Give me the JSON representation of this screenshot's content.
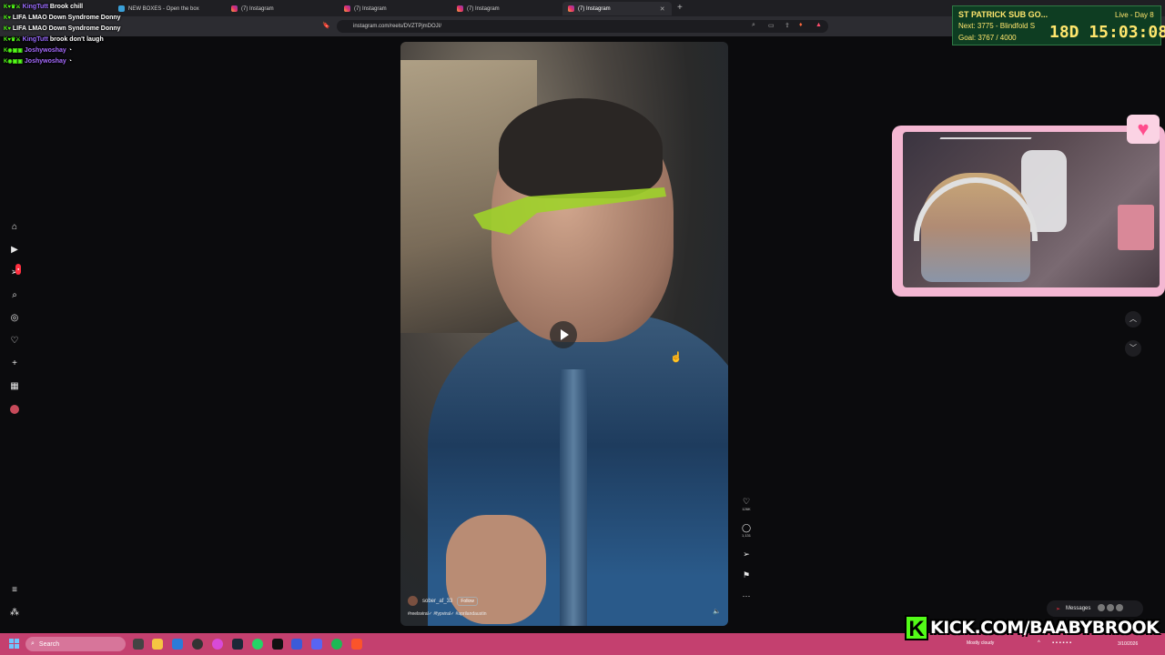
{
  "browser": {
    "tabs": [
      {
        "label": "NEW BOXES - Open the box",
        "active": false
      },
      {
        "label": "(7) Instagram",
        "active": false
      },
      {
        "label": "(7) Instagram",
        "active": false
      },
      {
        "label": "(7) Instagram",
        "active": false
      },
      {
        "label": "(7) Instagram",
        "active": true
      }
    ],
    "url": "instagram.com/reels/DVZTPjmDOJI/"
  },
  "chat": {
    "lines": [
      {
        "user": "KingTutt",
        "message": "Brook chill"
      },
      {
        "user": "LIFA",
        "message": "LMAO Down Syndrome Donny"
      },
      {
        "user": "LIFA",
        "message": "LMAO Down Syndrome Donny"
      },
      {
        "user": "KingTutt",
        "message": "brook don't laugh"
      },
      {
        "user": "Joshywoshay",
        "message": ""
      },
      {
        "user": "Joshywoshay",
        "message": ""
      }
    ]
  },
  "reel": {
    "username": "sober_af_33",
    "follow_label": "Follow",
    "caption": "#reelsviral✓ #fypviral✓ #aprilandaustin",
    "likes": "126K",
    "comments": "1,131"
  },
  "subgoal": {
    "title": "ST PATRICK SUB GO...",
    "live": "Live - Day 8",
    "next": "Next: 3775 - Blindfold S",
    "goal": "Goal: 3767 / 4000",
    "timer": "18D 15:03:08"
  },
  "messages": {
    "label": "Messages"
  },
  "kick": {
    "letter": "K",
    "text": "KICK.COM/BAABYBROOK"
  },
  "taskbar": {
    "search_placeholder": "Search",
    "weather": "Mostly cloudy",
    "date": "3/10/2026"
  },
  "colors": {
    "taskbar": "#c4406f",
    "kick_green": "#53fc18",
    "cam_border": "#f4b7d2",
    "subgoal_bg": "#0e3d22"
  }
}
